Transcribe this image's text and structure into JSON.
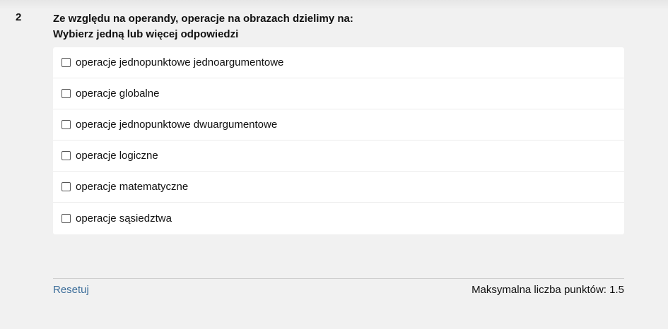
{
  "question": {
    "number": "2",
    "text": "Ze względu na operandy, operacje na obrazach dzielimy na:",
    "instruction": "Wybierz jedną lub więcej odpowiedzi"
  },
  "answers": [
    {
      "label": "operacje jednopunktowe jednoargumentowe",
      "checked": false
    },
    {
      "label": "operacje globalne",
      "checked": false
    },
    {
      "label": "operacje jednopunktowe dwuargumentowe",
      "checked": false
    },
    {
      "label": "operacje logiczne",
      "checked": false
    },
    {
      "label": "operacje matematyczne",
      "checked": false
    },
    {
      "label": "operacje sąsiedztwa",
      "checked": false
    }
  ],
  "footer": {
    "reset_label": "Resetuj",
    "max_points": "Maksymalna liczba punktów: 1.5"
  },
  "colors": {
    "background": "#f1f1f1",
    "panel": "#ffffff",
    "link": "#3d6e9a"
  }
}
